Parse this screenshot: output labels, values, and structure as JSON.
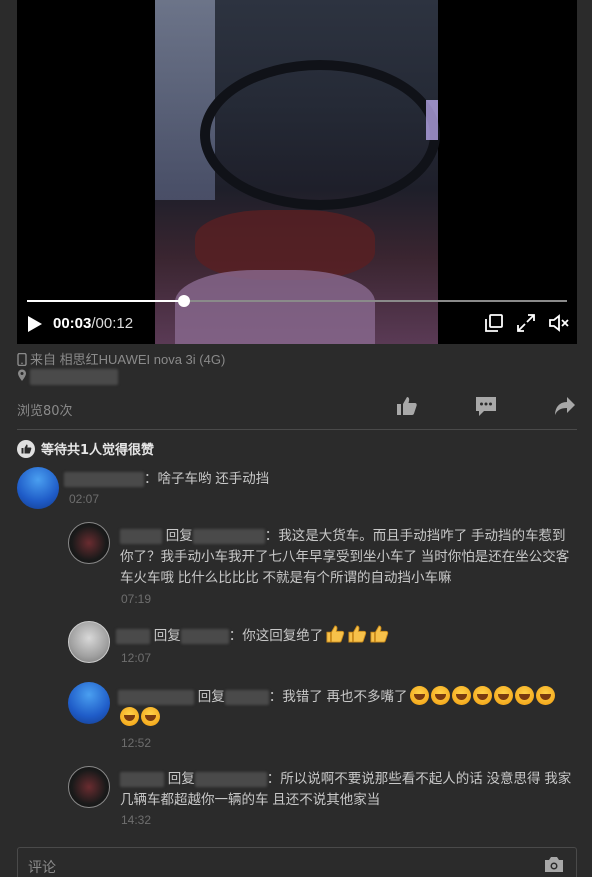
{
  "video": {
    "current_time": "00:03",
    "separator": "/",
    "total_time": "00:12",
    "progress_fraction": 0.29
  },
  "meta": {
    "source": "来自 相思红HUAWEI nova 3i (4G)"
  },
  "stats": {
    "views": "浏览80次"
  },
  "likes": {
    "text": "等待共1人觉得很赞"
  },
  "comments": [
    {
      "text": "：啥子车哟 还手动挡",
      "time": "02:07"
    },
    {
      "reply_word": "回复",
      "text": "：我这是大货车。而且手动挡咋了 手动挡的车惹到你了？我手动小车我开了七八年早享受到坐小车了 当时你怕是还在坐公交客车火车哦 比什么比比比 不就是有个所谓的自动挡小车嘛",
      "time": "07:19"
    },
    {
      "reply_word": "回复",
      "text": "：你这回复绝了",
      "time": "12:07"
    },
    {
      "reply_word": "回复",
      "text": "：我错了 再也不多嘴了",
      "time": "12:52"
    },
    {
      "reply_word": "回复",
      "text": "：所以说啊不要说那些看不起人的话 没意思得 我家几辆车都超越你一辆的车 且还不说其他家当",
      "time": "14:32"
    }
  ],
  "comment_input": {
    "placeholder": "评论"
  },
  "colors": {
    "background": "#2b2b2b",
    "text": "#c8c8c8",
    "muted": "#8a8a8a",
    "time": "#6e6e6e"
  }
}
